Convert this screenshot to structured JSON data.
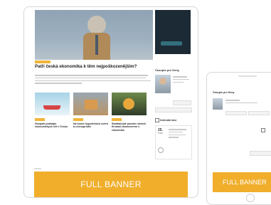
{
  "desktop": {
    "headline": "Patří česká ekonomika k těm nejpoškozenějším?",
    "articles": [
      {
        "title": "Hospodí podnájm ekonomických vět v Česku"
      },
      {
        "title": "Na konec hypotečních úvěrů tu menoprodiv"
      },
      {
        "title": "Startlakrade povede ročních firmami zkomoverem s cíkoomika"
      }
    ],
    "sidebar": {
      "title": "Časopis pro firmy",
      "calendar_title": "Kalendář akcí",
      "calendar_day": "25.",
      "calendar_month": "ŘÍJEN"
    },
    "banner": "FULL BANNER"
  },
  "tablet": {
    "sidebar_title": "Časopis pro firmy",
    "banner": "FULL BANNER"
  },
  "colors": {
    "banner": "#f0ae2b",
    "tag": "#f2b53a"
  }
}
